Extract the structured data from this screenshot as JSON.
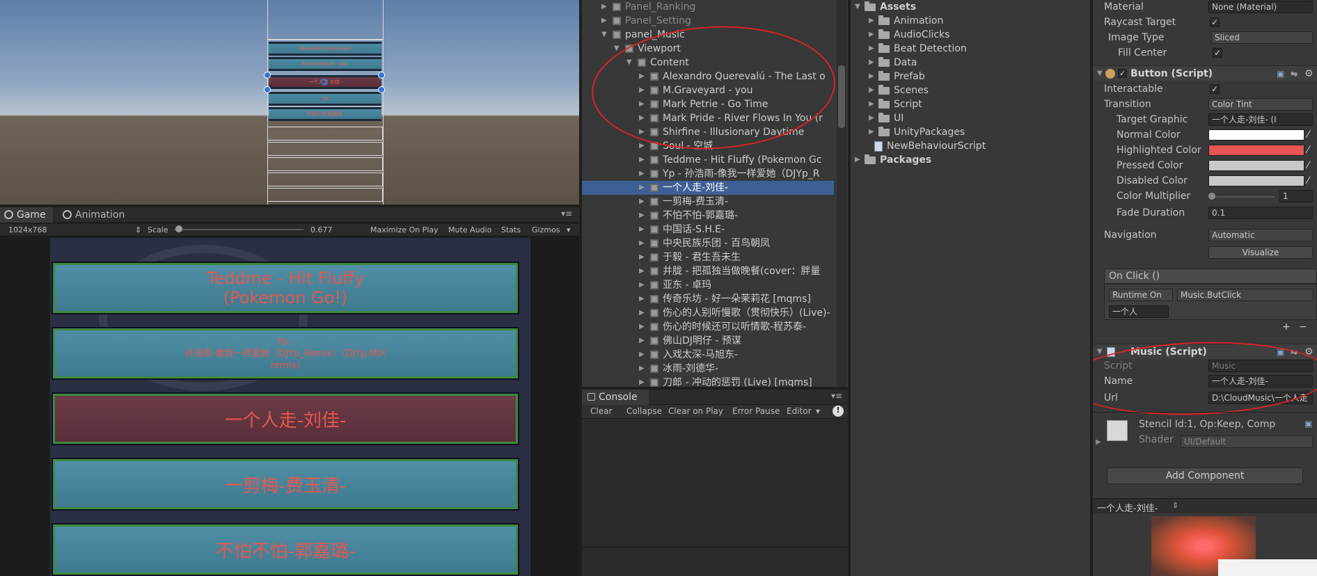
{
  "game": {
    "tabs": [
      {
        "label": "Game",
        "icon": "game-controller-icon"
      },
      {
        "label": "Animation",
        "icon": "animation-clock-icon"
      }
    ],
    "resolution": "1024x768",
    "scale_label": "Scale",
    "scale_value": "0.677",
    "scale_fraction": 0.677,
    "toolbar_buttons": [
      "Maximize On Play",
      "Mute Audio",
      "Stats",
      "Gizmos"
    ],
    "items": [
      {
        "lines": [
          "Teddme - Hit Fluffy",
          "(Pokemon Go!)"
        ],
        "selected": false
      },
      {
        "lines": [
          "Yp -",
          "孙浩雨-像我一样爱她（DJYp_Remix）（DjYp.MiX",
          "remix)"
        ],
        "selected": false
      },
      {
        "lines": [
          "一个人走-刘佳-"
        ],
        "selected": true
      },
      {
        "lines": [
          "一剪梅-费玉清-"
        ],
        "selected": false
      },
      {
        "lines": [
          "不怕不怕-郭嘉璐-"
        ],
        "selected": false
      }
    ],
    "accent_text_color": "#e4574f"
  },
  "scene": {
    "items": [
      "Alexandro Querevalú",
      "M.Graveyard - you",
      "一个人走-刘佳-",
      "Yp",
      "不怕不怕-郭嘉璐-"
    ]
  },
  "hierarchy": {
    "rows": [
      {
        "label": "Panel_Ranking",
        "depth": 1,
        "dim": true
      },
      {
        "label": "Panel_Setting",
        "depth": 1,
        "dim": true
      },
      {
        "label": "panel_Music",
        "depth": 1,
        "expanded": true
      },
      {
        "label": "Viewport",
        "depth": 2,
        "expanded": true
      },
      {
        "label": "Content",
        "depth": 3,
        "expanded": true
      },
      {
        "label": "Alexandro Querevalú - The Last o",
        "depth": 4
      },
      {
        "label": "M.Graveyard - you",
        "depth": 4
      },
      {
        "label": "Mark Petrie - Go Time",
        "depth": 4
      },
      {
        "label": "Mark Pride - River Flows In You (r",
        "depth": 4
      },
      {
        "label": "Shirfine - Illusionary Daytime",
        "depth": 4
      },
      {
        "label": "Soul - 空城",
        "depth": 4
      },
      {
        "label": "Teddme - Hit Fluffy (Pokemon Gc",
        "depth": 4
      },
      {
        "label": "Yp - 孙浩雨-像我一样爱她（DJYp_R",
        "depth": 4
      },
      {
        "label": "一个人走-刘佳-",
        "depth": 4,
        "selected": true
      },
      {
        "label": "一剪梅-费玉清-",
        "depth": 4
      },
      {
        "label": "不怕不怕-郭嘉璐-",
        "depth": 4
      },
      {
        "label": "中国话-S.H.E-",
        "depth": 4
      },
      {
        "label": "中央民族乐团 - 百鸟朝凤",
        "depth": 4
      },
      {
        "label": "于毅 - 君生吾未生",
        "depth": 4
      },
      {
        "label": "井胧 - 把孤独当做晚餐(cover：胖量",
        "depth": 4
      },
      {
        "label": "亚东 - 卓玛",
        "depth": 4
      },
      {
        "label": "传奇乐坊 - 好一朵茉莉花 [mqms]",
        "depth": 4
      },
      {
        "label": "伤心的人别听慢歌（贯彻快乐）(Live)-",
        "depth": 4
      },
      {
        "label": "伤心的时候还可以听情歌-程苏泰-",
        "depth": 4
      },
      {
        "label": "佛山DJ明仔 - 预谋",
        "depth": 4
      },
      {
        "label": "入戏太深-马旭东-",
        "depth": 4
      },
      {
        "label": "冰雨-刘德华-",
        "depth": 4
      },
      {
        "label": "刀郎 - 冲动的惩罚 (Live) [mqms]",
        "depth": 4
      }
    ]
  },
  "console": {
    "tab_label": "Console",
    "buttons": [
      "Clear",
      "Collapse",
      "Clear on Play",
      "Error Pause",
      "Editor"
    ]
  },
  "project": {
    "assets_label": "Assets",
    "folders": [
      "Animation",
      "AudioClicks",
      "Beat Detection",
      "Data",
      "Prefab",
      "Scenes",
      "Script",
      "UI",
      "UnityPackages"
    ],
    "file": "NewBehaviourScript",
    "packages_label": "Packages"
  },
  "inspector": {
    "image": {
      "material_label": "Material",
      "material_value": "None (Material)",
      "raycast_label": "Raycast Target",
      "image_type_label": "Image Type",
      "image_type_value": "Sliced",
      "fill_center_label": "Fill Center"
    },
    "button": {
      "title": "Button (Script)",
      "interactable_label": "Interactable",
      "transition_label": "Transition",
      "transition_value": "Color Tint",
      "target_graphic_label": "Target Graphic",
      "target_graphic_value": "一个人走-刘佳- (I",
      "normal_color_label": "Normal Color",
      "highlighted_color_label": "Highlighted Color",
      "pressed_color_label": "Pressed Color",
      "disabled_color_label": "Disabled Color",
      "color_multiplier_label": "Color Multiplier",
      "color_multiplier_value": "1",
      "fade_duration_label": "Fade Duration",
      "fade_duration_value": "0.1",
      "navigation_label": "Navigation",
      "navigation_value": "Automatic",
      "visualize_label": "Visualize",
      "onclick_label": "On Click ()",
      "runtime_value": "Runtime On",
      "function_value": "Music.ButClick",
      "object_value": "一个人",
      "colors": {
        "normal": "#ffffff",
        "highlighted": "#e85555",
        "pressed": "#c8c8c8",
        "disabled": "#c8c8c8"
      }
    },
    "music": {
      "title": "Music (Script)",
      "script_label": "Script",
      "script_value": "Music",
      "name_label": "Name",
      "name_value": "一个人走-刘佳-",
      "url_label": "Url",
      "url_value": "D:\\CloudMusic\\一个人走"
    },
    "material": {
      "title": "Stencil Id:1, Op:Keep, Comp",
      "shader_label": "Shader",
      "shader_value": "UI/Default"
    },
    "add_component_label": "Add Component",
    "preview_name": "一个人走-刘佳-"
  }
}
